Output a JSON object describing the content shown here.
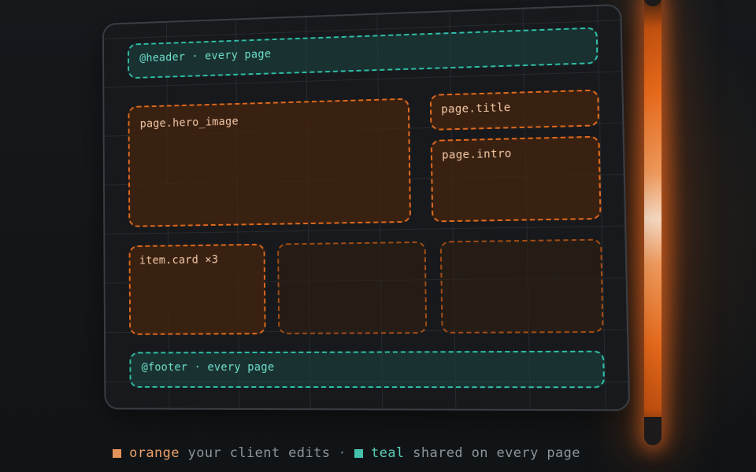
{
  "wireframe": {
    "header_label": "@header · every page",
    "hero_label": "page.hero_image",
    "title_label": "page.title",
    "intro_label": "page.intro",
    "card_label": "item.card ×3",
    "footer_label": "@footer · every page"
  },
  "legend": {
    "orange_word": "orange",
    "orange_text": " your client edits",
    "separator": "·",
    "teal_word": "teal",
    "teal_text": " shared on every page"
  },
  "colors": {
    "orange": "#e06a1e",
    "teal": "#2fbfa8",
    "glow": "#e8691a"
  }
}
